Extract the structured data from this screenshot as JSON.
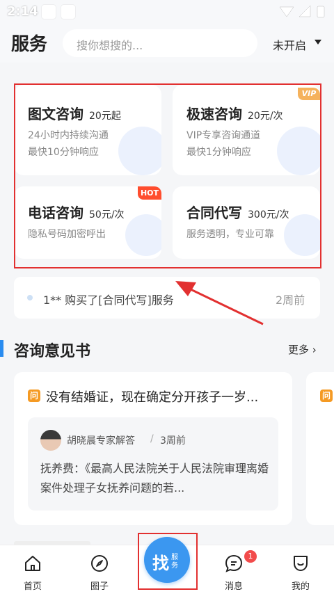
{
  "status_bar": {
    "time": "2:14"
  },
  "header": {
    "title": "服务",
    "search_placeholder": "搜你想搜的...",
    "city": "未开启"
  },
  "services": [
    {
      "title": "图文咨询",
      "price": "20元起",
      "desc1": "24小时内持续沟通",
      "desc2": "最快10分钟响应",
      "tag": ""
    },
    {
      "title": "极速咨询",
      "price": "20元/次",
      "desc1": "VIP专享咨询通道",
      "desc2": "最快1分钟响应",
      "tag": "VIP"
    },
    {
      "title": "电话咨询",
      "price": "50元/次",
      "desc1": "隐私号码加密呼出",
      "desc2": "",
      "tag": "HOT"
    },
    {
      "title": "合同代写",
      "price": "300元/次",
      "desc1": "服务透明，专业可靠",
      "desc2": "",
      "tag": ""
    }
  ],
  "ticker": {
    "text": "1** 购买了[合同代写]服务",
    "time": "2周前"
  },
  "section": {
    "title": "咨询意见书",
    "more": "更多"
  },
  "opinion": {
    "badge": "问",
    "question": "没有结婚证，现在确定分开孩子一岁...",
    "expert": "胡晓晨专家解答",
    "separator": "/",
    "time": "3周前",
    "answer": "抚养费：《最高人民法院关于人民法院审理离婚案件处理子女抚养问题的若..."
  },
  "bottom_nav": {
    "home": "首页",
    "circle": "圈子",
    "find_main": "找",
    "find_sub": "服务",
    "messages": "消息",
    "messages_badge": "1",
    "mine": "我的"
  },
  "colors": {
    "accent": "#3b97f0",
    "highlight_red": "#e23030",
    "hot": "#ff4d2e",
    "vip": "#f5b25c",
    "question_badge": "#f59a23"
  }
}
